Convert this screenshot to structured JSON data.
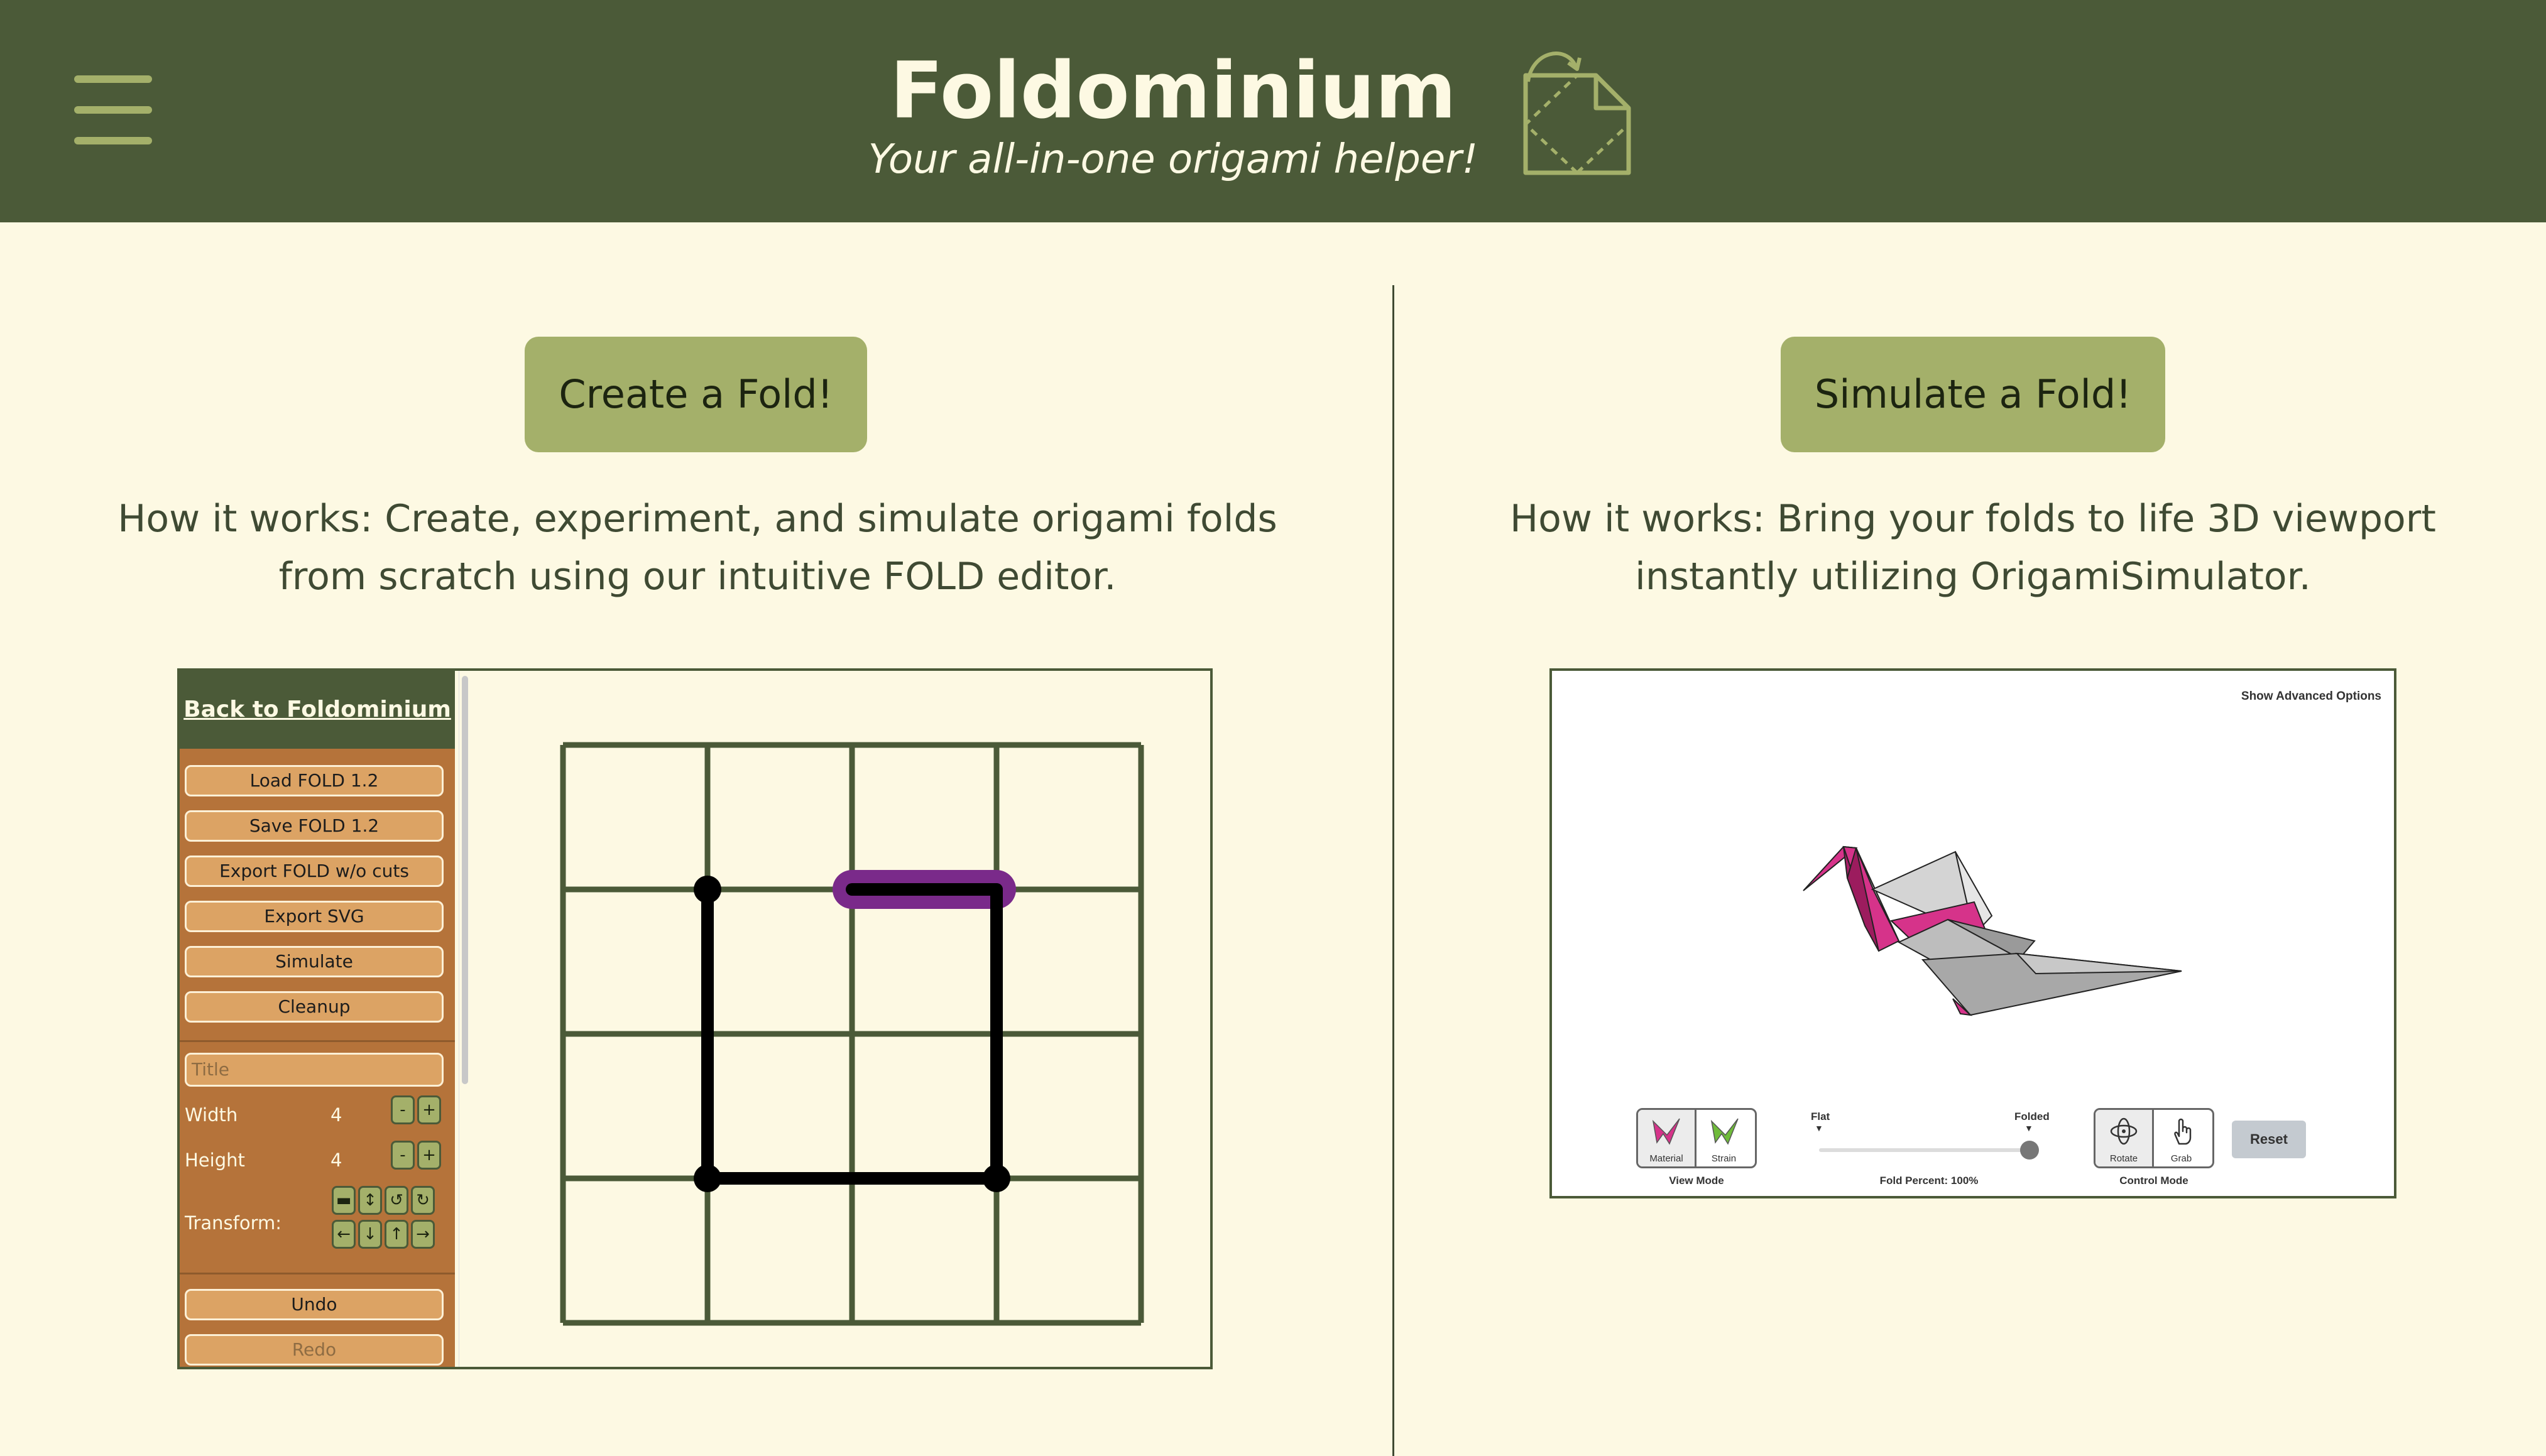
{
  "header": {
    "title": "Foldominium",
    "subtitle": "Your all-in-one origami helper!",
    "menu_icon": "hamburger-menu-icon",
    "logo_icon": "fold-paper-logo"
  },
  "create": {
    "button": "Create a Fold!",
    "description": "How it works: Create, experiment, and simulate origami folds from scratch using our intuitive FOLD editor."
  },
  "simulate": {
    "button": "Simulate a Fold!",
    "description": "How it works: Bring your folds to life 3D viewport instantly utilizing OrigamiSimulator."
  },
  "editor": {
    "back_link": "Back to Foldominium",
    "buttons": [
      "Load FOLD 1.2",
      "Save FOLD 1.2",
      "Export FOLD w/o cuts",
      "Export SVG",
      "Simulate",
      "Cleanup"
    ],
    "title_placeholder": "Title",
    "width_label": "Width",
    "width_value": "4",
    "height_label": "Height",
    "height_value": "4",
    "stepper_minus": "-",
    "stepper_plus": "+",
    "transform_label": "Transform:",
    "transform_symbols": [
      "▬",
      "↕",
      "↺",
      "↻",
      "←",
      "↓",
      "↑",
      "→"
    ],
    "undo": "Undo",
    "redo": "Redo",
    "grid_size": 4
  },
  "simulator": {
    "advanced_link": "Show Advanced Options",
    "view_mode": {
      "label": "View Mode",
      "options": [
        "Material",
        "Strain"
      ]
    },
    "fold_slider": {
      "flat_label": "Flat",
      "folded_label": "Folded",
      "caption": "Fold Percent: 100%",
      "value": 1.0
    },
    "control_mode": {
      "label": "Control Mode",
      "options": [
        "Rotate",
        "Grab"
      ]
    },
    "reset": "Reset"
  },
  "colors": {
    "header_bg": "#4b5a38",
    "page_bg": "#fdf9e3",
    "accent": "#a4b06a",
    "editor_sidebar": "#b5733a",
    "highlight_edge": "#7a2a8a",
    "crane_pink": "#d6338a"
  }
}
